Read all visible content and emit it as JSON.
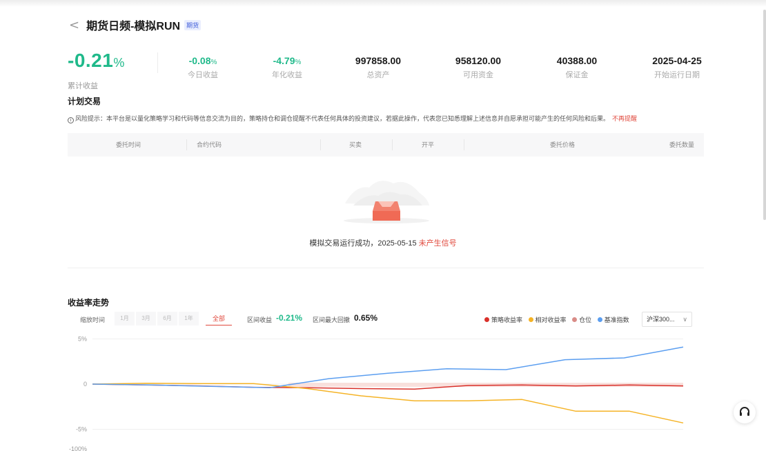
{
  "header": {
    "back_glyph": "<",
    "title": "期货日频-模拟RUN",
    "tag": "期货"
  },
  "metrics": {
    "cumulative": {
      "value": "-0.21",
      "unit": "%",
      "label": "累计收益"
    },
    "items": [
      {
        "value": "-0.08",
        "unit": "%",
        "label": "今日收益",
        "color": "#1fb98a"
      },
      {
        "value": "-4.79",
        "unit": "%",
        "label": "年化收益",
        "color": "#1fb98a"
      },
      {
        "value": "997858.00",
        "unit": "",
        "label": "总资产",
        "color": "#1a1a1a"
      },
      {
        "value": "958120.00",
        "unit": "",
        "label": "可用资金",
        "color": "#1a1a1a"
      },
      {
        "value": "40388.00",
        "unit": "",
        "label": "保证金",
        "color": "#1a1a1a"
      },
      {
        "value": "2025-04-25",
        "unit": "",
        "label": "开始运行日期",
        "color": "#1a1a1a"
      }
    ]
  },
  "plan": {
    "title": "计划交易",
    "risk_icon": "i",
    "risk_text": "风险提示：本平台是以量化策略学习和代码等信息交流为目的，策略持仓和调仓提醒不代表任何具体的投资建议，若据此操作，代表您已知悉理解上述信息并自愿承担可能产生的任何风险和后果。",
    "dismiss": "不再提醒",
    "columns": [
      "委托时间",
      "合约代码",
      "买卖",
      "开平",
      "委托价格",
      "委托数量"
    ],
    "empty_text": "模拟交易运行成功，2025-05-15",
    "empty_status": "未产生信号"
  },
  "returns": {
    "title": "收益率走势",
    "zoom_label": "缩放时间",
    "ranges": [
      "1月",
      "3月",
      "6月",
      "1年",
      "全部"
    ],
    "active_range": "全部",
    "interval_return_label": "区间收益",
    "interval_return_value": "-0.21%",
    "max_drawdown_label": "区间最大回撤",
    "max_drawdown_value": "0.65%",
    "legend": [
      {
        "name": "策略收益率",
        "color": "#d9302a"
      },
      {
        "name": "相对收益率",
        "color": "#f5b325"
      },
      {
        "name": "仓位",
        "color": "#d98c87"
      },
      {
        "name": "基准指数",
        "color": "#5b9ef0"
      }
    ],
    "benchmark_select": "沪深300...",
    "chevron_glyph": "∨"
  },
  "chart_data": {
    "type": "line",
    "y_ticks": [
      "5%",
      "0",
      "-5%",
      "-100%"
    ],
    "ylim": [
      -5,
      5
    ],
    "series": [
      {
        "name": "策略收益率",
        "color": "#d9302a",
        "values": [
          0,
          -0.1,
          -0.2,
          -0.35,
          -0.4,
          -0.5,
          -0.55,
          -0.15,
          -0.1,
          -0.2,
          -0.1,
          -0.2
        ]
      },
      {
        "name": "相对收益率",
        "color": "#f5b325",
        "values": [
          0,
          0.1,
          0.05,
          0.05,
          -0.5,
          -1.3,
          -1.85,
          -1.85,
          -1.7,
          -3.0,
          -3.0,
          -4.3
        ]
      },
      {
        "name": "基准指数",
        "color": "#5b9ef0",
        "values": [
          0,
          -0.1,
          -0.25,
          -0.4,
          0.6,
          1.2,
          1.7,
          1.6,
          2.7,
          2.9,
          4.1
        ]
      }
    ],
    "position_band": {
      "name": "仓位",
      "color": "#f7d9d6"
    }
  },
  "icons": {
    "back": "chevron-left-icon",
    "info": "info-circle-icon",
    "empty": "empty-box-icon",
    "support": "headset-icon"
  }
}
